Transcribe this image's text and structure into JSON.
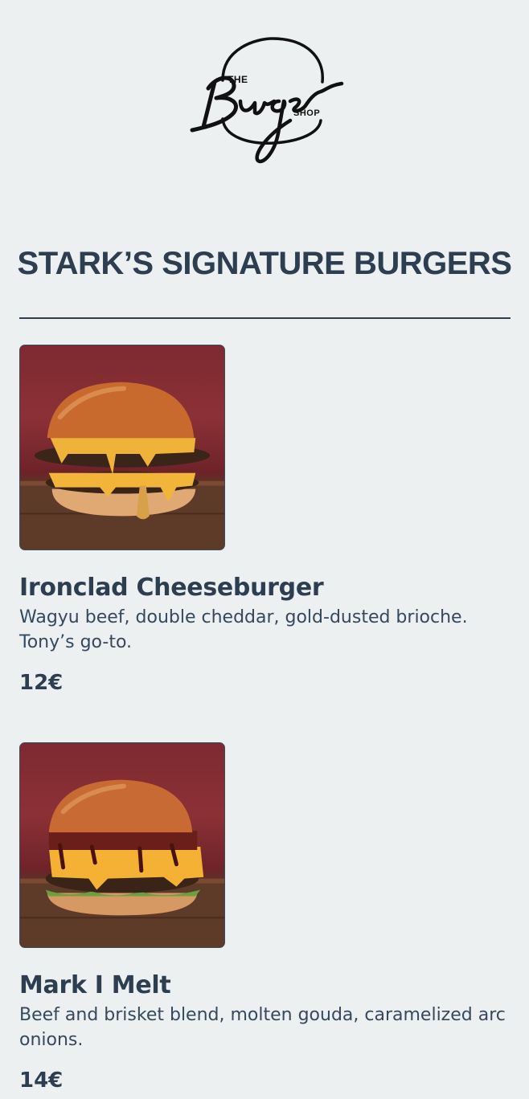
{
  "logo": {
    "the": "THE",
    "main": "Burger",
    "shop": "SHOP"
  },
  "section": {
    "title": "STARK’S SIGNATURE BURGERS"
  },
  "items": [
    {
      "name": "Ironclad Cheeseburger",
      "description": "Wagyu beef, double cheddar, gold-dusted brioche. Tony’s go-to.",
      "price": "12€",
      "image": "cheeseburger-photo"
    },
    {
      "name": "Mark I Melt",
      "description": "Beef and brisket blend, molten gouda, caramelized arc onions.",
      "price": "14€",
      "image": "melt-burger-photo"
    }
  ],
  "colors": {
    "background": "#ecf0f1",
    "text": "#2c3e50",
    "photo_backdrop": "#7d2a30"
  }
}
